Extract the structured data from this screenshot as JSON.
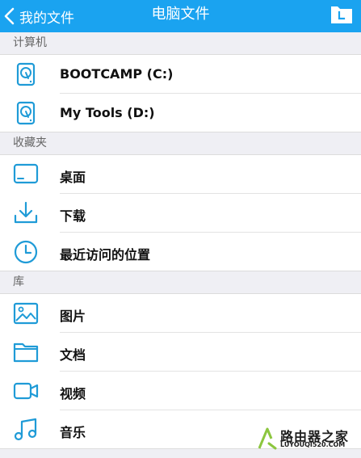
{
  "navbar": {
    "back_label": "我的文件",
    "title": "电脑文件",
    "action_icon": "folder-icon"
  },
  "sections": [
    {
      "header": "计算机",
      "items": [
        {
          "label": "BOOTCAMP (C:)",
          "icon": "hard-drive-icon"
        },
        {
          "label": "My Tools (D:)",
          "icon": "hard-drive-icon"
        }
      ]
    },
    {
      "header": "收藏夹",
      "items": [
        {
          "label": "桌面",
          "icon": "desktop-icon"
        },
        {
          "label": "下载",
          "icon": "download-icon"
        },
        {
          "label": "最近访问的位置",
          "icon": "clock-icon"
        }
      ]
    },
    {
      "header": "库",
      "items": [
        {
          "label": "图片",
          "icon": "image-icon"
        },
        {
          "label": "文档",
          "icon": "folder-icon"
        },
        {
          "label": "视频",
          "icon": "video-icon"
        },
        {
          "label": "音乐",
          "icon": "music-icon"
        }
      ]
    }
  ],
  "watermark": {
    "main": "路由器之家",
    "sub": "LUYOUQI520.COM"
  },
  "colors": {
    "accent": "#1aa3f0",
    "icon": "#1f9bd7"
  }
}
